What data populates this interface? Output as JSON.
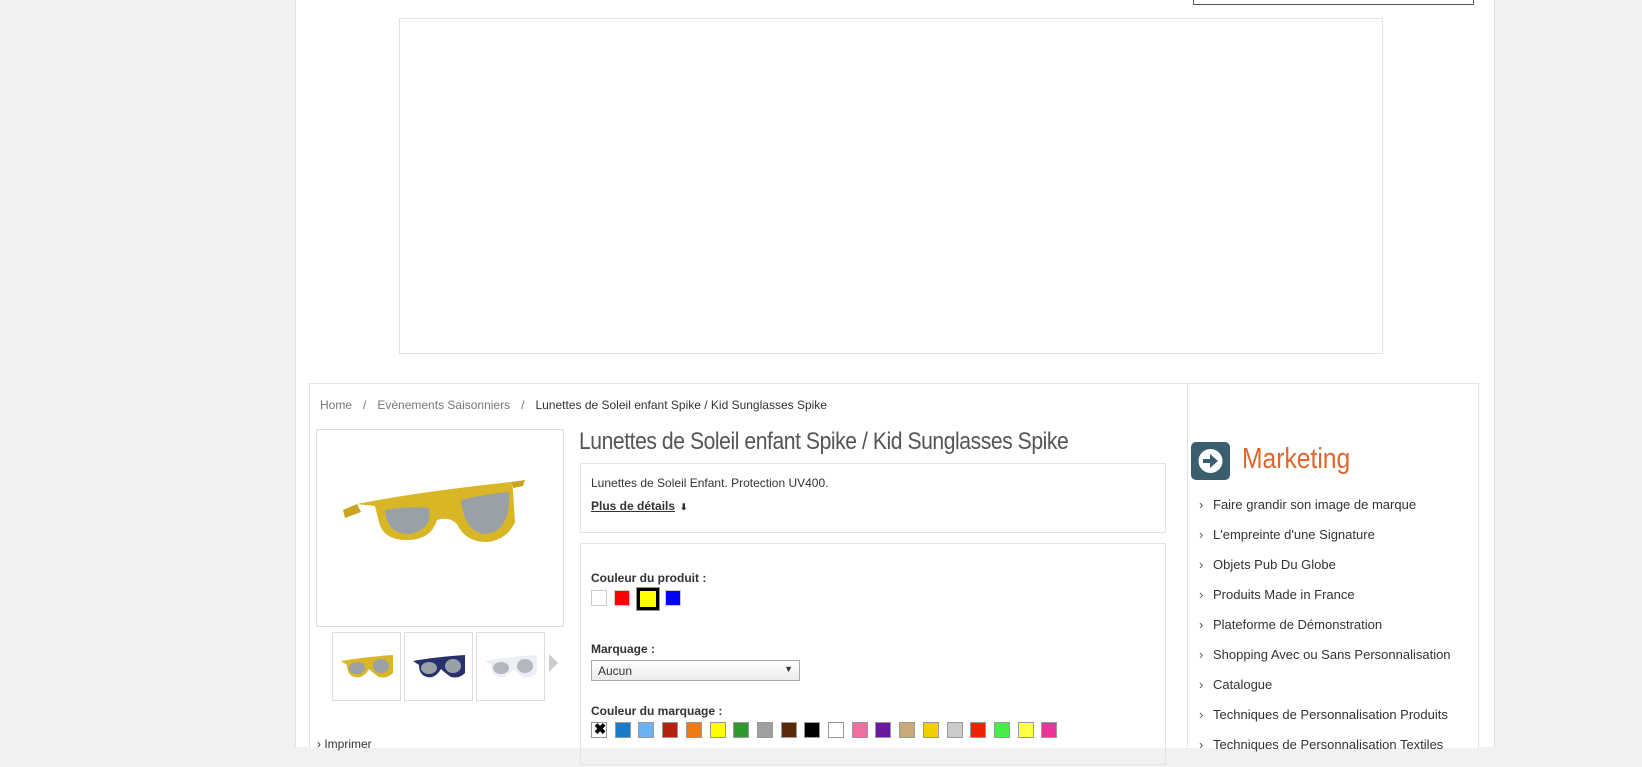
{
  "breadcrumb": {
    "home": "Home",
    "category": "Evènements Saisonniers",
    "current": "Lunettes de Soleil enfant Spike / Kid Sunglasses Spike",
    "separator": "/"
  },
  "product": {
    "title": "Lunettes de Soleil enfant Spike / Kid Sunglasses Spike",
    "short_description": "Lunettes de Soleil Enfant. Protection UV400.",
    "more_details": "Plus de détails",
    "color_label": "Couleur du produit :",
    "colors": [
      "#ffffff",
      "#ff0000",
      "#ffff00",
      "#0000ff"
    ],
    "selected_color": "#ffff00",
    "marking_label": "Marquage :",
    "marking_value": "Aucun",
    "marking_color_label": "Couleur du marquage :",
    "marking_colors": [
      "none",
      "#1a7bc9",
      "#6cb2f2",
      "#b5210f",
      "#ec7a15",
      "#ffff00",
      "#2e9a2e",
      "#a0a0a0",
      "#5a2a0a",
      "#000000",
      "#ffffff",
      "#f06fa0",
      "#6a1aa0",
      "#c8aa7a",
      "#f0d000",
      "#cccccc",
      "#ee2200",
      "#44ee44",
      "#ffff44",
      "#ee3399"
    ],
    "thumbnails": [
      "yellow",
      "navy",
      "white"
    ],
    "print_link": "Imprimer"
  },
  "sidebar": {
    "title": "Marketing",
    "items": [
      "Faire grandir son image de marque",
      "L'empreinte d'une Signature",
      "Objets Pub Du Globe",
      "Produits Made in France",
      "Plateforme de Démonstration",
      "Shopping Avec ou Sans Personnalisation",
      "Catalogue",
      "Techniques de Personnalisation Produits",
      "Techniques de Personnalisation Textiles"
    ]
  }
}
